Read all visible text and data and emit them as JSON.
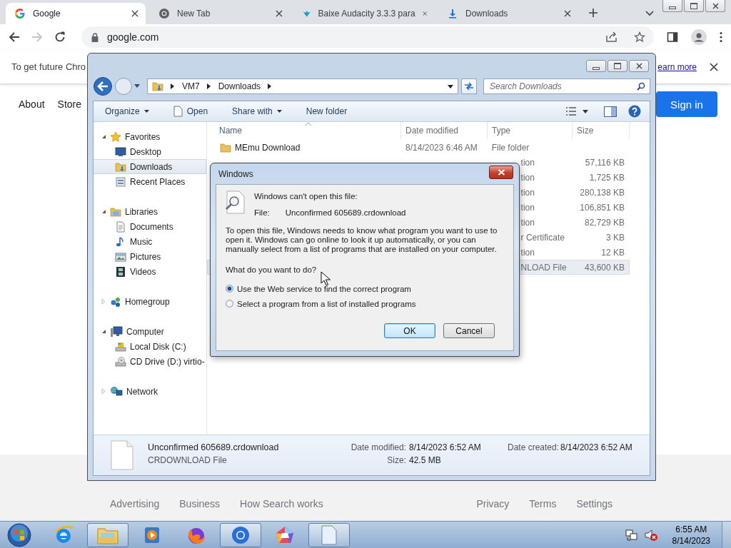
{
  "browser": {
    "tabs": [
      {
        "title": "Google",
        "selected": true
      },
      {
        "title": "New Tab",
        "selected": false
      },
      {
        "title": "Baixe Audacity 3.3.3 para",
        "selected": false
      },
      {
        "title": "Downloads",
        "selected": false
      }
    ],
    "back": {
      "disabled": false
    },
    "forward": {
      "disabled": true
    },
    "address": "google.com",
    "infobar": {
      "text": "To get future Chro",
      "link": "earn more"
    }
  },
  "page": {
    "nav_links": [
      "About",
      "Store"
    ],
    "sign_in": "Sign in",
    "footer_left": [
      "Advertising",
      "Business",
      "How Search works"
    ],
    "footer_right": [
      "Privacy",
      "Terms",
      "Settings"
    ]
  },
  "explorer": {
    "path": [
      "VM7",
      "Downloads"
    ],
    "search_placeholder": "Search Downloads",
    "commands": [
      {
        "label": "Organize",
        "dropdown": true
      },
      {
        "label": "Open",
        "dropdown": false
      },
      {
        "label": "Share with",
        "dropdown": true
      },
      {
        "label": "New folder",
        "dropdown": false
      }
    ],
    "nav": [
      {
        "label": "Favorites",
        "expanded": true,
        "children": [
          {
            "label": "Desktop",
            "selected": false
          },
          {
            "label": "Downloads",
            "selected": true
          },
          {
            "label": "Recent Places",
            "selected": false
          }
        ]
      },
      {
        "label": "Libraries",
        "expanded": true,
        "children": [
          {
            "label": "Documents",
            "selected": false
          },
          {
            "label": "Music",
            "selected": false
          },
          {
            "label": "Pictures",
            "selected": false
          },
          {
            "label": "Videos",
            "selected": false
          }
        ]
      },
      {
        "label": "Homegroup",
        "expanded": false
      },
      {
        "label": "Computer",
        "expanded": true,
        "children": [
          {
            "label": "Local Disk (C:)",
            "selected": false
          },
          {
            "label": "CD Drive (D:) virtio-",
            "selected": false
          }
        ]
      },
      {
        "label": "Network",
        "expanded": false
      }
    ],
    "columns": [
      "Name",
      "Date modified",
      "Type",
      "Size"
    ],
    "rows": [
      {
        "name": "MEmu Download",
        "date": "8/14/2023 6:46 AM",
        "type": "File folder",
        "selected": false
      },
      {
        "type": "tion",
        "size": "57,116 KB",
        "selected": false
      },
      {
        "type": "tion",
        "size": "1,725 KB",
        "selected": false
      },
      {
        "type": "tion",
        "size": "280,138 KB",
        "selected": false
      },
      {
        "type": "tion",
        "size": "106,851 KB",
        "selected": false
      },
      {
        "type": "tion",
        "size": "82,729 KB",
        "selected": false
      },
      {
        "type": "r Certificate",
        "size": "3 KB",
        "selected": false
      },
      {
        "type": "tion",
        "size": "12 KB",
        "selected": false
      },
      {
        "type": "NLOAD File",
        "size": "43,600 KB",
        "selected": true
      }
    ],
    "details": {
      "name": "Unconfirmed 605689.crdownload",
      "type": "CRDOWNLOAD File",
      "fields": [
        {
          "label": "Date modified:",
          "value": "8/14/2023 6:52 AM"
        },
        {
          "label": "Size:",
          "value": "42.5 MB"
        },
        {
          "label": "Date created:",
          "value": "8/14/2023 6:52 AM"
        }
      ]
    }
  },
  "dialog": {
    "title": "Windows",
    "heading": "Windows can't open this file:",
    "file_label": "File:",
    "file_name": "Unconfirmed 605689.crdownload",
    "body": "To open this file, Windows needs to know what program you want to use to open it. Windows can go online to look it up automatically, or you can manually select from a list of programs that are installed on your computer.",
    "question": "What do you want to do?",
    "options": [
      {
        "label": "Use the Web service to find the correct program",
        "selected": true
      },
      {
        "label": "Select a program from a list of installed programs",
        "selected": false
      }
    ],
    "buttons": [
      {
        "label": "OK",
        "default": true
      },
      {
        "label": "Cancel",
        "default": false
      }
    ]
  },
  "taskbar": {
    "apps": [
      {
        "running": false
      },
      {
        "running": true
      },
      {
        "running": false
      },
      {
        "running": false
      },
      {
        "running": true
      },
      {
        "running": false
      },
      {
        "running": true
      }
    ],
    "time": "6:55 AM",
    "date": "8/14/2023"
  }
}
